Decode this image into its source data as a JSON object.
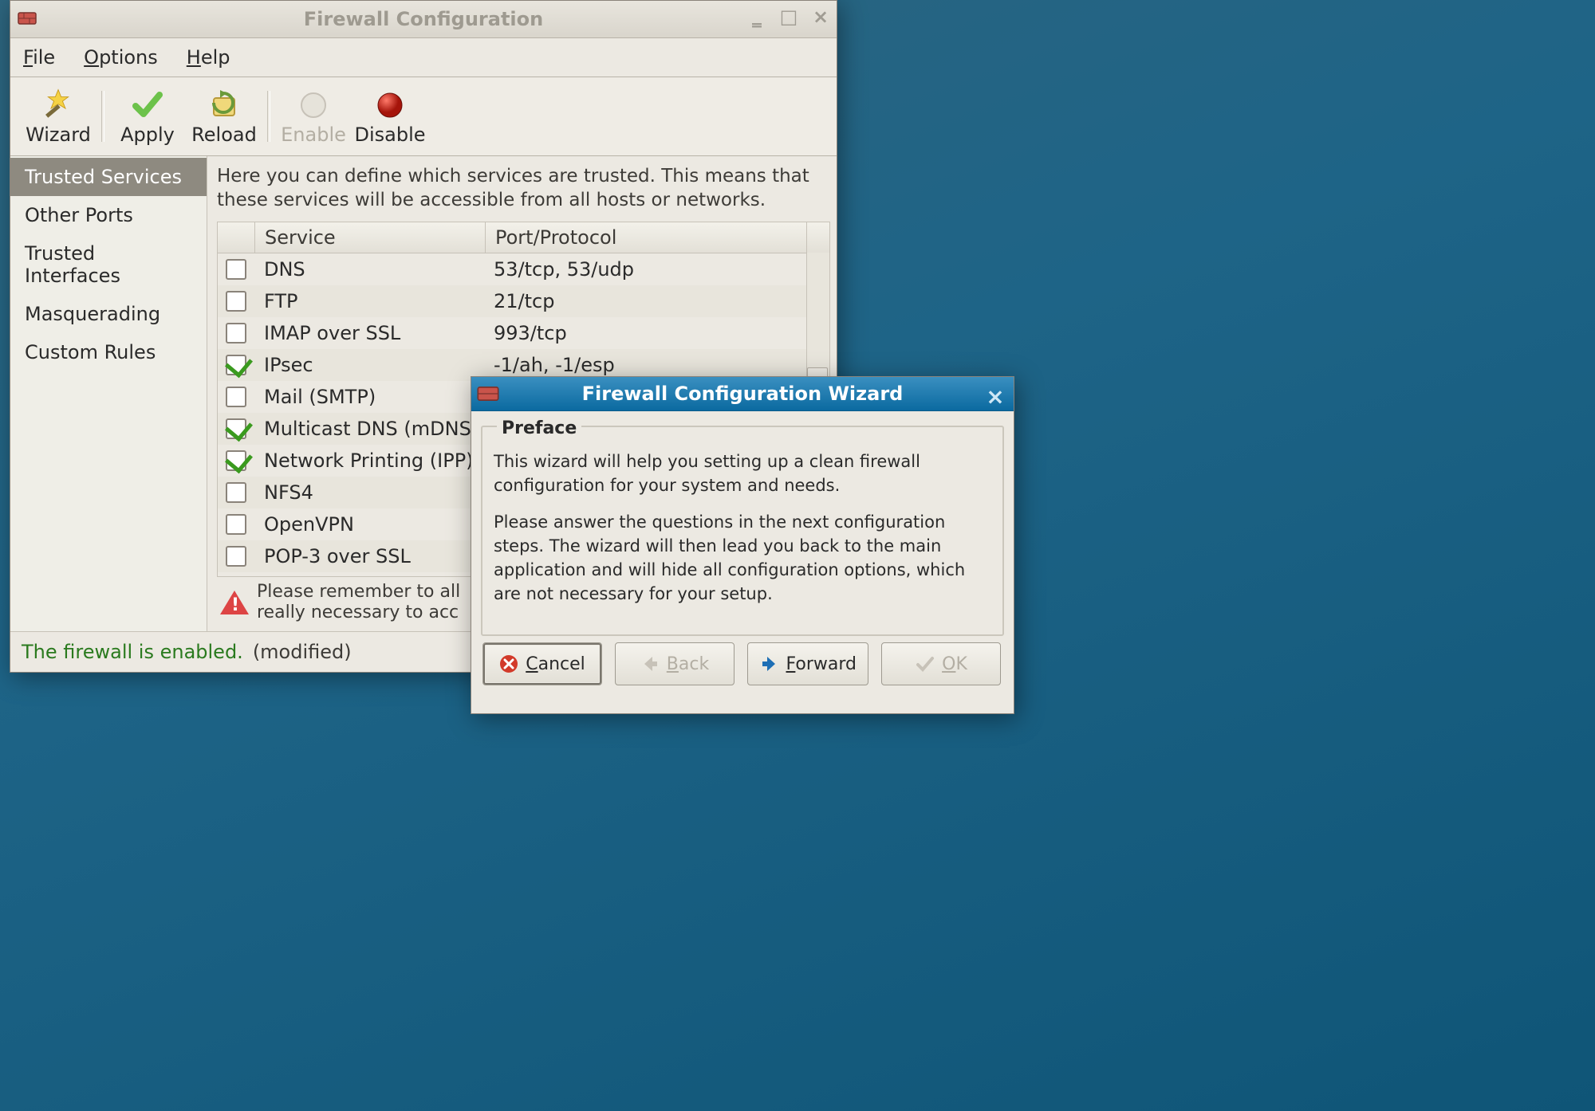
{
  "main_window": {
    "title": "Firewall Configuration",
    "menubar": {
      "file": "File",
      "options": "Options",
      "help": "Help"
    },
    "toolbar": {
      "wizard": "Wizard",
      "apply": "Apply",
      "reload": "Reload",
      "enable": "Enable",
      "disable": "Disable"
    },
    "sidebar": {
      "items": [
        {
          "label": "Trusted Services",
          "selected": true
        },
        {
          "label": "Other Ports",
          "selected": false
        },
        {
          "label": "Trusted Interfaces",
          "selected": false
        },
        {
          "label": "Masquerading",
          "selected": false
        },
        {
          "label": "Custom Rules",
          "selected": false
        }
      ]
    },
    "content": {
      "description": "Here you can define which services are trusted. This means that these services will be accessible from all hosts or networks.",
      "header_service": "Service",
      "header_port": "Port/Protocol",
      "rows": [
        {
          "checked": false,
          "service": "DNS",
          "port": "53/tcp, 53/udp"
        },
        {
          "checked": false,
          "service": "FTP",
          "port": "21/tcp"
        },
        {
          "checked": false,
          "service": "IMAP over SSL",
          "port": "993/tcp"
        },
        {
          "checked": true,
          "service": "IPsec",
          "port": "-1/ah, -1/esp"
        },
        {
          "checked": false,
          "service": "Mail (SMTP)",
          "port": ""
        },
        {
          "checked": true,
          "service": "Multicast DNS (mDNS)",
          "port": ""
        },
        {
          "checked": true,
          "service": "Network Printing (IPP)",
          "port": ""
        },
        {
          "checked": false,
          "service": "NFS4",
          "port": ""
        },
        {
          "checked": false,
          "service": "OpenVPN",
          "port": ""
        },
        {
          "checked": false,
          "service": "POP-3 over SSL",
          "port": ""
        }
      ],
      "footer_warning_l1": "Please remember to all",
      "footer_warning_l2": "really necessary to acc"
    },
    "statusbar": {
      "enabled_text": "The firewall is enabled.",
      "modified_text": "(modified)"
    }
  },
  "wizard": {
    "title": "Firewall Configuration Wizard",
    "legend": "Preface",
    "para1": "This wizard will help you setting up a clean firewall configuration for your system and needs.",
    "para2": "Please answer the questions in the next configuration steps. The wizard will then lead you back to the main application and will hide all configuration options, which are not necessary for your setup.",
    "buttons": {
      "cancel": "Cancel",
      "back": "Back",
      "forward": "Forward",
      "ok": "OK"
    }
  }
}
